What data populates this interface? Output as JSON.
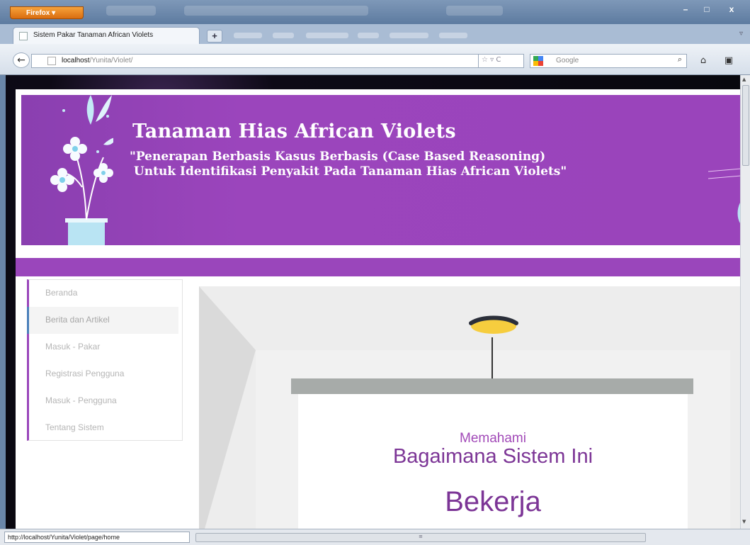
{
  "browser": {
    "app_button": "Firefox",
    "tab_title": "Sistem Pakar Tanaman African Violets",
    "new_tab": "+",
    "url_host": "localhost",
    "url_path": "/Yunita/Violet/",
    "search_placeholder": "Google",
    "status_url": "http://localhost/Yunita/Violet/page/home",
    "window_controls": {
      "minimize": "–",
      "maximize": "□",
      "close": "x"
    }
  },
  "banner": {
    "title": "Tanaman Hias African Violets",
    "subtitle": "\"Penerapan Berbasis Kasus Berbasis (Case Based Reasoning)\n Untuk Identifikasi Penyakit Pada Tanaman Hias African Violets\""
  },
  "sidebar": {
    "items": [
      {
        "label": "Beranda"
      },
      {
        "label": "Berita dan Artikel"
      },
      {
        "label": "Masuk - Pakar"
      },
      {
        "label": "Registrasi Pengguna"
      },
      {
        "label": "Masuk - Pengguna"
      },
      {
        "label": "Tentang Sistem"
      }
    ],
    "active_index": 1
  },
  "hero": {
    "line1": "Memahami",
    "line2": "Bagaimana Sistem Ini",
    "line3": "Bekerja"
  },
  "colors": {
    "banner": "#9a46bb",
    "accent_text": "#7c3596",
    "active_border": "#4b80bb"
  }
}
